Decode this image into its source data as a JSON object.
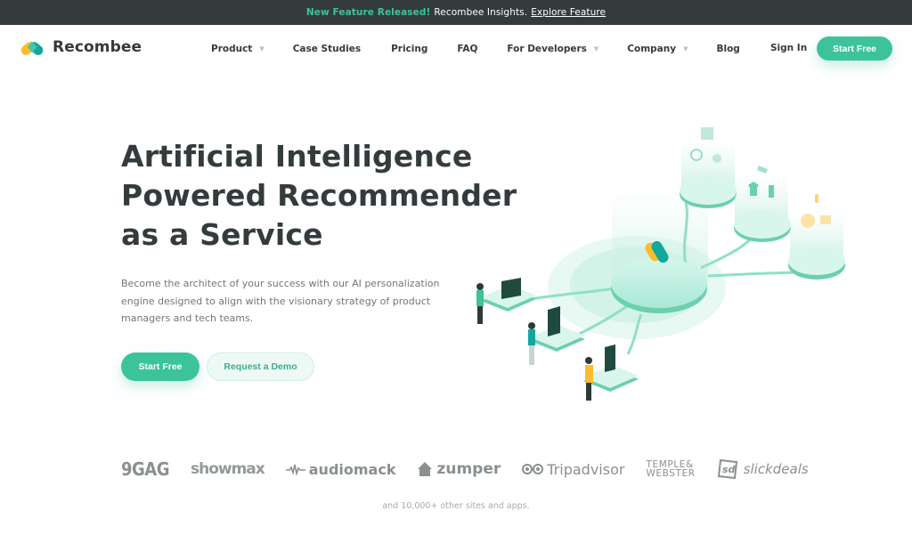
{
  "announcement": {
    "highlight": "New Feature Released!",
    "text": "Recombee Insights.",
    "link": "Explore Feature"
  },
  "brand": {
    "name": "Recombee",
    "logo_icon": "recombee-logo-icon"
  },
  "nav": {
    "items": [
      {
        "label": "Product",
        "has_dropdown": true
      },
      {
        "label": "Case Studies",
        "has_dropdown": false
      },
      {
        "label": "Pricing",
        "has_dropdown": false
      },
      {
        "label": "FAQ",
        "has_dropdown": false
      },
      {
        "label": "For Developers",
        "has_dropdown": true
      },
      {
        "label": "Company",
        "has_dropdown": true
      },
      {
        "label": "Blog",
        "has_dropdown": false
      }
    ],
    "caret_icon": "chevron-down-icon",
    "sign_in": "Sign In",
    "cta": "Start Free"
  },
  "hero": {
    "title_lines": [
      "Artificial Intelligence",
      "Powered Recommender",
      "as a Service"
    ],
    "description": "Become the architect of your success with our AI personalization engine designed to align with the visionary strategy of product managers and tech teams.",
    "primary_button": "Start Free",
    "secondary_button": "Request a Demo",
    "illustration": "isometric-recommender-network-illustration"
  },
  "clients": {
    "logos": [
      "9GAG",
      "showmax",
      "audiomack",
      "zumper",
      "Tripadvisor",
      "TEMPLE&",
      "WEBSTER",
      "slickdeals"
    ],
    "more_text": "and 10,000+ other sites and apps."
  },
  "colors": {
    "brand_green": "#3cc39b",
    "dark": "#343b3d",
    "logo_yellow": "#fbbd2e",
    "logo_teal": "#12a79d"
  }
}
